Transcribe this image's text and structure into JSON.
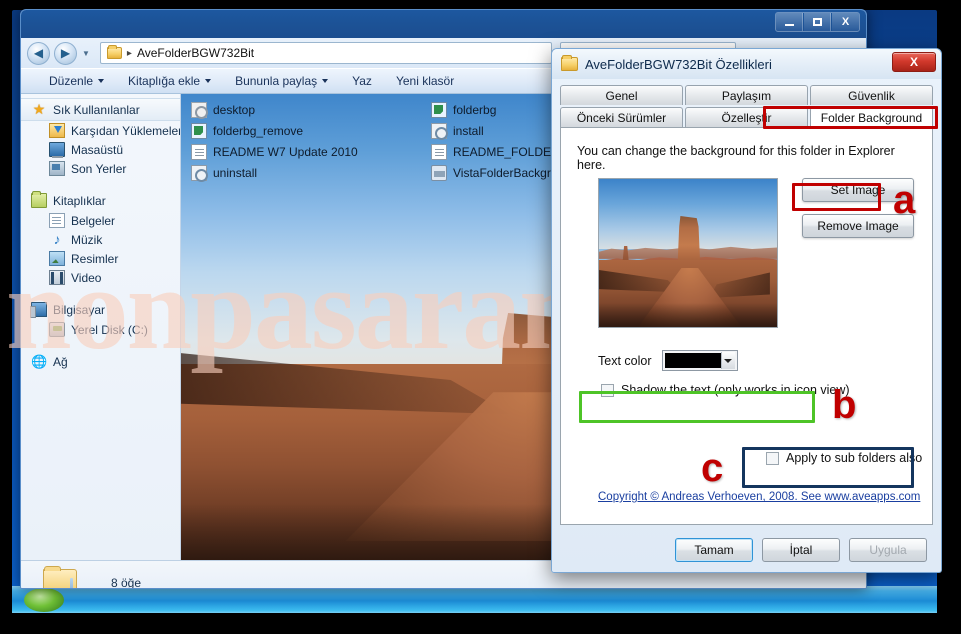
{
  "watermark": {
    "text": "nonpasaran"
  },
  "explorer": {
    "window_controls": {
      "minimize": "–",
      "maximize": "□",
      "close": "X"
    },
    "address": {
      "path": "AveFolderBGW732Bit",
      "separator": "▸",
      "folder_icon": "folder-icon"
    },
    "search": {
      "placeholder": "",
      "value": "",
      "icon": "search-icon"
    },
    "commandbar": [
      {
        "label": "Düzenle",
        "has_caret": true
      },
      {
        "label": "Kitaplığa ekle",
        "has_caret": true
      },
      {
        "label": "Bununla paylaş",
        "has_caret": true
      },
      {
        "label": "Yaz",
        "has_caret": false
      },
      {
        "label": "Yeni klasör",
        "has_caret": false
      }
    ],
    "navigation": [
      {
        "label": "Sık Kullanılanlar",
        "icon": "star-icon",
        "level": 0,
        "selected": true
      },
      {
        "label": "Karşıdan Yüklemeler",
        "icon": "downloads-folder-icon",
        "level": 1,
        "selected": false
      },
      {
        "label": "Masaüstü",
        "icon": "desktop-icon",
        "level": 1,
        "selected": false
      },
      {
        "label": "Son Yerler",
        "icon": "recent-places-icon",
        "level": 1,
        "selected": false
      },
      {
        "label": "Kitaplıklar",
        "icon": "libraries-icon",
        "level": 0,
        "selected": false
      },
      {
        "label": "Belgeler",
        "icon": "documents-icon",
        "level": 1,
        "selected": false
      },
      {
        "label": "Müzik",
        "icon": "music-icon",
        "level": 1,
        "selected": false
      },
      {
        "label": "Resimler",
        "icon": "pictures-icon",
        "level": 1,
        "selected": false
      },
      {
        "label": "Video",
        "icon": "video-icon",
        "level": 1,
        "selected": false
      },
      {
        "label": "Bilgisayar",
        "icon": "computer-icon",
        "level": 0,
        "selected": false
      },
      {
        "label": "Yerel Disk (C:)",
        "icon": "local-disk-icon",
        "level": 1,
        "selected": false
      },
      {
        "label": "Ağ",
        "icon": "network-icon",
        "level": 0,
        "selected": false
      }
    ],
    "files": [
      {
        "name": "desktop",
        "icon": "config-file-icon"
      },
      {
        "name": "folderbg",
        "icon": "registry-file-icon"
      },
      {
        "name": "folderbg_remove",
        "icon": "registry-file-icon"
      },
      {
        "name": "install",
        "icon": "info-file-icon"
      },
      {
        "name": "README W7 Update 2010",
        "icon": "text-file-icon"
      },
      {
        "name": "README_FOLDERB",
        "icon": "text-file-icon"
      },
      {
        "name": "uninstall",
        "icon": "info-file-icon"
      },
      {
        "name": "VistaFolderBackgro",
        "icon": "dll-file-icon"
      }
    ],
    "details": {
      "count_label": "8 öğe",
      "folder_icon": "folder-icon"
    }
  },
  "dialog": {
    "title": "AveFolderBGW732Bit Özellikleri",
    "folder_icon": "folder-icon",
    "close_label": "X",
    "tabs_row1": [
      {
        "label": "Genel",
        "active": false
      },
      {
        "label": "Paylaşım",
        "active": false
      },
      {
        "label": "Güvenlik",
        "active": false
      }
    ],
    "tabs_row2": [
      {
        "label": "Önceki Sürümler",
        "active": false
      },
      {
        "label": "Özelleştir",
        "active": false
      },
      {
        "label": "Folder Background",
        "active": true
      }
    ],
    "panel": {
      "description": "You can change the background for this folder in Explorer here.",
      "preview_alt": "folder-background-preview",
      "set_image_label": "Set Image",
      "remove_image_label": "Remove Image",
      "text_color_label": "Text color",
      "text_color_value": "#000000",
      "shadow_checkbox": {
        "label": "Shadow the text (only works in icon view)",
        "checked": false
      },
      "subfolders_checkbox": {
        "label": "Apply to sub folders also",
        "checked": false
      },
      "copyright_link": "Copyright © Andreas Verhoeven, 2008. See www.aveapps.com"
    },
    "footer": [
      {
        "label": "Tamam",
        "style": "primary"
      },
      {
        "label": "İptal",
        "style": "normal"
      },
      {
        "label": "Uygula",
        "style": "disabled"
      }
    ]
  },
  "annotations": [
    {
      "label": "a",
      "color": "#c00000",
      "target": "set-image-button"
    },
    {
      "label": "b",
      "color": "#c00000",
      "target": "shadow-checkbox"
    },
    {
      "label": "c",
      "color": "#c00000",
      "target": "apply-subfolders-checkbox"
    }
  ],
  "highlights": {
    "red": "#c00000",
    "green": "#4ec427",
    "navy": "#14355e"
  }
}
